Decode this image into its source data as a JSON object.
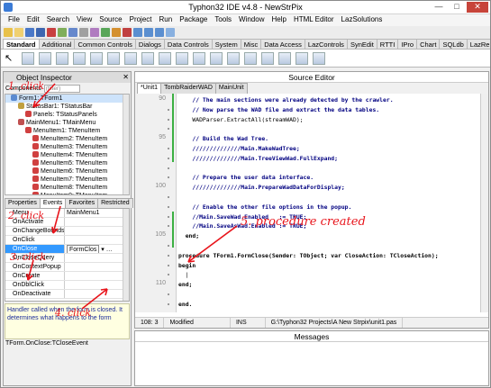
{
  "window": {
    "title": "Typhon32 IDE v4.8 - NewStrPix",
    "controls": [
      "—",
      "□",
      "✕"
    ]
  },
  "menu": [
    "File",
    "Edit",
    "Search",
    "View",
    "Source",
    "Project",
    "Run",
    "Package",
    "Tools",
    "Window",
    "Help",
    "HTML Editor",
    "LazSolutions"
  ],
  "palette_tabs": [
    "Standard",
    "Additional",
    "Common Controls",
    "Dialogs",
    "Data Controls",
    "System",
    "Misc",
    "Data Access",
    "LazControls",
    "SynEdit",
    "RTTI",
    "IPro",
    "Chart",
    "SQLdb",
    "LazReport",
    "Da"
  ],
  "object_inspector": {
    "title": "Object Inspector",
    "components_label": "Components",
    "filter_placeholder": "(filter)",
    "tree": [
      {
        "label": "Form1: TForm1",
        "indent": 0,
        "selected": true
      },
      {
        "label": "StatusBar1: TStatusBar",
        "indent": 1
      },
      {
        "label": "Panels: TStatusPanels",
        "indent": 2
      },
      {
        "label": "MainMenu1: TMainMenu",
        "indent": 1
      },
      {
        "label": "MenuItem1: TMenuItem",
        "indent": 2
      },
      {
        "label": "MenuItem2: TMenuItem",
        "indent": 3
      },
      {
        "label": "MenuItem3: TMenuItem",
        "indent": 3
      },
      {
        "label": "MenuItem4: TMenuItem",
        "indent": 3
      },
      {
        "label": "MenuItem5: TMenuItem",
        "indent": 3
      },
      {
        "label": "MenuItem6: TMenuItem",
        "indent": 3
      },
      {
        "label": "MenuItem7: TMenuItem",
        "indent": 3
      },
      {
        "label": "MenuItem8: TMenuItem",
        "indent": 3
      },
      {
        "label": "MenuItem9: TMenuItem",
        "indent": 3
      }
    ],
    "tabs": [
      "Properties",
      "Events",
      "Favorites",
      "Restricted"
    ],
    "events": [
      {
        "name": "Menu",
        "value": "MainMenu1"
      },
      {
        "name": "OnActivate",
        "value": ""
      },
      {
        "name": "OnChangeBounds",
        "value": ""
      },
      {
        "name": "OnClick",
        "value": ""
      },
      {
        "name": "OnClose",
        "value": "FormClos",
        "selected": true
      },
      {
        "name": "OnCloseQuery",
        "value": ""
      },
      {
        "name": "OnContextPopup",
        "value": ""
      },
      {
        "name": "OnCreate",
        "value": ""
      },
      {
        "name": "OnDblClick",
        "value": ""
      },
      {
        "name": "OnDeactivate",
        "value": ""
      }
    ],
    "hint": "Handler called when the form is closed. It determines what happens to the form",
    "status": "TForm.OnClose:TCloseEvent"
  },
  "source_editor": {
    "title": "Source Editor",
    "tabs": [
      "*Unit1",
      "TombRaiderWAD",
      "MainUnit"
    ],
    "lines": [
      {
        "num": "90",
        "text": "    // The main sections were already detected by the crawler.",
        "style": "cm"
      },
      {
        "num": "",
        "text": "    // Now parse the WAD file and extract the data tables.",
        "style": "cm"
      },
      {
        "num": "",
        "text": "    WADParser.ExtractAll(streamWAD);",
        "style": ""
      },
      {
        "num": "",
        "text": "",
        "style": ""
      },
      {
        "num": "95",
        "text": "    // Build the Wad Tree.",
        "style": "cm"
      },
      {
        "num": "",
        "text": "    //////////////Main.MakeWadTree;",
        "style": "cm"
      },
      {
        "num": "",
        "text": "    //////////////Main.TreeViewWad.FullExpand;",
        "style": "cm"
      },
      {
        "num": "",
        "text": "",
        "style": ""
      },
      {
        "num": "",
        "text": "    // Prepare the user data interface.",
        "style": "cm"
      },
      {
        "num": "100",
        "text": "    //////////////Main.PrepareWadDataForDisplay;",
        "style": "cm"
      },
      {
        "num": "",
        "text": "",
        "style": ""
      },
      {
        "num": "",
        "text": "    // Enable the other file options in the popup.",
        "style": "cm"
      },
      {
        "num": "",
        "text": "    //Main.SaveWad.Enabled   := TRUE;",
        "style": "cm"
      },
      {
        "num": "",
        "text": "    //Main.SaveAsWad.Enabled := TRUE;",
        "style": "cm"
      },
      {
        "num": "105",
        "text": "  end;",
        "style": "kw"
      },
      {
        "num": "",
        "text": "",
        "style": ""
      },
      {
        "num": "",
        "text": "procedure TForm1.FormClose(Sender: TObject; var CloseAction: TCloseAction);",
        "style": "kw"
      },
      {
        "num": "",
        "text": "begin",
        "style": "kw"
      },
      {
        "num": "",
        "text": "  |",
        "style": ""
      },
      {
        "num": "110",
        "text": "end;",
        "style": "kw"
      },
      {
        "num": "",
        "text": "",
        "style": ""
      },
      {
        "num": "",
        "text": "end.",
        "style": "kw"
      }
    ],
    "status": [
      "108: 3",
      "Modified",
      "INS",
      "G:\\Typhon32 Projects\\A New Strpix\\unit1.pas"
    ]
  },
  "messages": {
    "title": "Messages"
  },
  "annotations": {
    "step1": "1. click",
    "step2": "2. click",
    "step3": "3. click",
    "step4": "4. click",
    "step5": "5. procedure created"
  },
  "colors": {
    "annotation": "#e8141b",
    "selection": "#3399ff",
    "change_bar": "#3cb043",
    "comment": "#000080"
  }
}
